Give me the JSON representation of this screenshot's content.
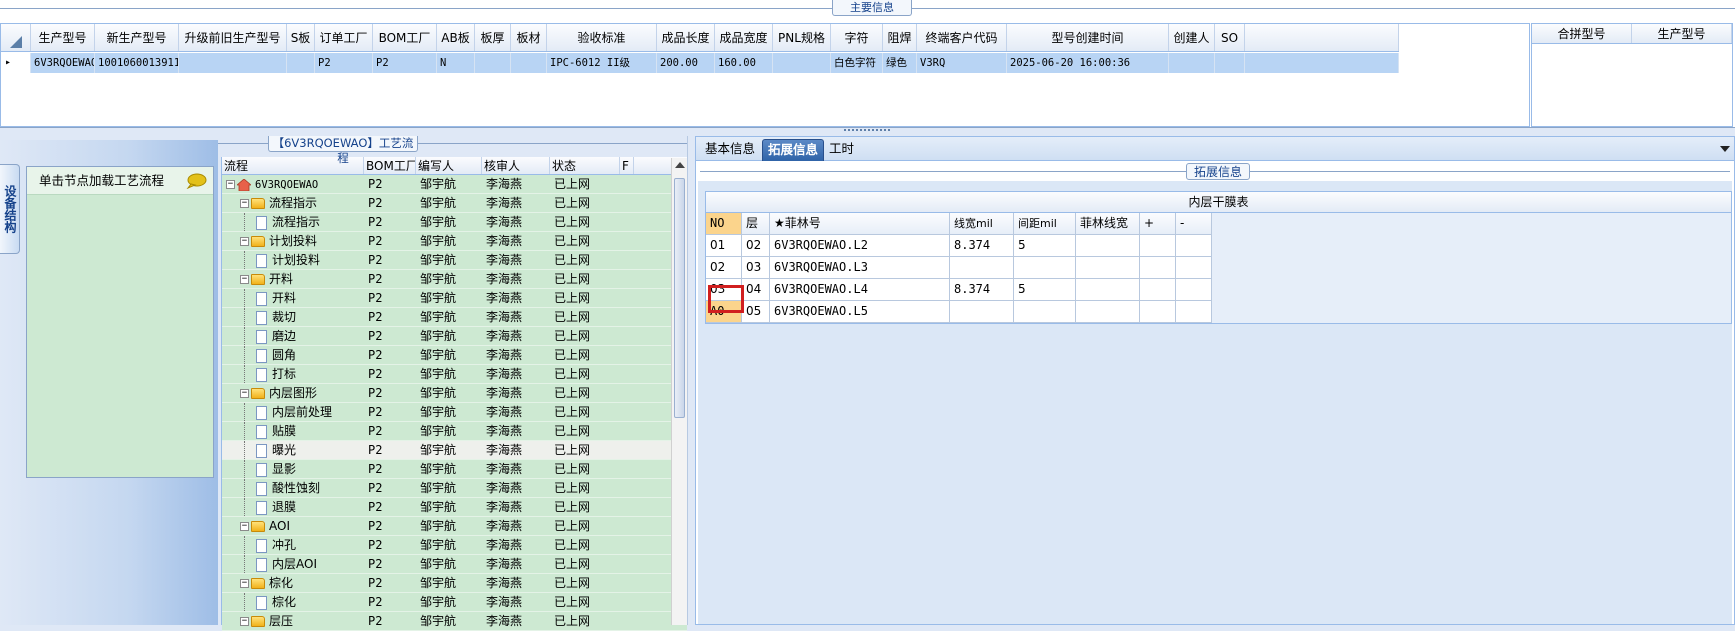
{
  "top": {
    "section_title": "主要信息",
    "columns": [
      "",
      "生产型号",
      "新生产型号",
      "升级前旧生产型号",
      "S板",
      "订单工厂",
      "BOM工厂",
      "AB板",
      "板厚",
      "板材",
      "验收标准",
      "成品长度",
      "成品宽度",
      "PNL规格",
      "字符",
      "阻焊",
      "终端客户代码",
      "型号创建时间",
      "创建人",
      "SO",
      ""
    ],
    "row": [
      "▸",
      "6V3RQOEWAO",
      "10010600139116",
      "",
      "",
      "P2",
      "P2",
      "N",
      "",
      "",
      "IPC-6012 II级",
      "200.00",
      "160.00",
      "",
      "白色字符",
      "绿色",
      "V3RQ",
      "2025-06-20 16:00:36",
      "",
      "",
      ""
    ],
    "merge_columns": [
      "合拼型号",
      "生产型号"
    ]
  },
  "left": {
    "vertical_tab": "设备结构",
    "panel_title": "单击节点加载工艺流程",
    "bubble_icon": "speech-bubble-icon"
  },
  "flow": {
    "title": "【6V3RQOEWAO】工艺流程",
    "columns": [
      "流程",
      "BOM工厂",
      "编写人",
      "核审人",
      "状态",
      "F"
    ],
    "rows": [
      {
        "name": "6V3RQOEWAO",
        "type": "root",
        "level": 0,
        "bom": "P2",
        "writer": "邹宇航",
        "reviewer": "李海燕",
        "status": "已上网"
      },
      {
        "name": "流程指示",
        "type": "folder",
        "level": 1,
        "bom": "P2",
        "writer": "邹宇航",
        "reviewer": "李海燕",
        "status": "已上网"
      },
      {
        "name": "流程指示",
        "type": "doc",
        "level": 2,
        "bom": "P2",
        "writer": "邹宇航",
        "reviewer": "李海燕",
        "status": "已上网"
      },
      {
        "name": "计划投料",
        "type": "folder",
        "level": 1,
        "bom": "P2",
        "writer": "邹宇航",
        "reviewer": "李海燕",
        "status": "已上网"
      },
      {
        "name": "计划投料",
        "type": "doc",
        "level": 2,
        "bom": "P2",
        "writer": "邹宇航",
        "reviewer": "李海燕",
        "status": "已上网"
      },
      {
        "name": "开料",
        "type": "folder",
        "level": 1,
        "bom": "P2",
        "writer": "邹宇航",
        "reviewer": "李海燕",
        "status": "已上网"
      },
      {
        "name": "开料",
        "type": "doc",
        "level": 2,
        "bom": "P2",
        "writer": "邹宇航",
        "reviewer": "李海燕",
        "status": "已上网"
      },
      {
        "name": "裁切",
        "type": "doc",
        "level": 2,
        "bom": "P2",
        "writer": "邹宇航",
        "reviewer": "李海燕",
        "status": "已上网"
      },
      {
        "name": "磨边",
        "type": "doc",
        "level": 2,
        "bom": "P2",
        "writer": "邹宇航",
        "reviewer": "李海燕",
        "status": "已上网"
      },
      {
        "name": "圆角",
        "type": "doc",
        "level": 2,
        "bom": "P2",
        "writer": "邹宇航",
        "reviewer": "李海燕",
        "status": "已上网"
      },
      {
        "name": "打标",
        "type": "doc",
        "level": 2,
        "bom": "P2",
        "writer": "邹宇航",
        "reviewer": "李海燕",
        "status": "已上网"
      },
      {
        "name": "内层图形",
        "type": "folder",
        "level": 1,
        "bom": "P2",
        "writer": "邹宇航",
        "reviewer": "李海燕",
        "status": "已上网"
      },
      {
        "name": "内层前处理",
        "type": "doc",
        "level": 2,
        "bom": "P2",
        "writer": "邹宇航",
        "reviewer": "李海燕",
        "status": "已上网"
      },
      {
        "name": "贴膜",
        "type": "doc",
        "level": 2,
        "bom": "P2",
        "writer": "邹宇航",
        "reviewer": "李海燕",
        "status": "已上网"
      },
      {
        "name": "曝光",
        "type": "doc",
        "level": 2,
        "bom": "P2",
        "writer": "邹宇航",
        "reviewer": "李海燕",
        "status": "已上网",
        "selected": true
      },
      {
        "name": "显影",
        "type": "doc",
        "level": 2,
        "bom": "P2",
        "writer": "邹宇航",
        "reviewer": "李海燕",
        "status": "已上网"
      },
      {
        "name": "酸性蚀刻",
        "type": "doc",
        "level": 2,
        "bom": "P2",
        "writer": "邹宇航",
        "reviewer": "李海燕",
        "status": "已上网"
      },
      {
        "name": "退膜",
        "type": "doc",
        "level": 2,
        "bom": "P2",
        "writer": "邹宇航",
        "reviewer": "李海燕",
        "status": "已上网"
      },
      {
        "name": "AOI",
        "type": "folder",
        "level": 1,
        "bom": "P2",
        "writer": "邹宇航",
        "reviewer": "李海燕",
        "status": "已上网"
      },
      {
        "name": "冲孔",
        "type": "doc",
        "level": 2,
        "bom": "P2",
        "writer": "邹宇航",
        "reviewer": "李海燕",
        "status": "已上网"
      },
      {
        "name": "内层AOI",
        "type": "doc",
        "level": 2,
        "bom": "P2",
        "writer": "邹宇航",
        "reviewer": "李海燕",
        "status": "已上网"
      },
      {
        "name": "棕化",
        "type": "folder",
        "level": 1,
        "bom": "P2",
        "writer": "邹宇航",
        "reviewer": "李海燕",
        "status": "已上网"
      },
      {
        "name": "棕化",
        "type": "doc",
        "level": 2,
        "bom": "P2",
        "writer": "邹宇航",
        "reviewer": "李海燕",
        "status": "已上网"
      },
      {
        "name": "层压",
        "type": "folder",
        "level": 1,
        "bom": "P2",
        "writer": "邹宇航",
        "reviewer": "李海燕",
        "status": "已上网"
      }
    ]
  },
  "right": {
    "tabs": [
      "基本信息",
      "拓展信息",
      "工时"
    ],
    "active_tab": "拓展信息",
    "section_title": "拓展信息",
    "table_title": "内层干膜表",
    "columns": [
      "NO",
      "层",
      "★菲林号",
      "线宽mil",
      "间距mil",
      "菲林线宽",
      "+",
      "-"
    ],
    "rows": [
      [
        "01",
        "02",
        "6V3RQOEWAO.L2",
        "8.374",
        "5",
        "",
        "",
        ""
      ],
      [
        "02",
        "03",
        "6V3RQOEWAO.L3",
        "",
        "",
        "",
        "",
        ""
      ],
      [
        "03",
        "04",
        "6V3RQOEWAO.L4",
        "8.374",
        "5",
        "",
        "",
        ""
      ],
      [
        "A0",
        "05",
        "6V3RQOEWAO.L5",
        "",
        "",
        "",
        "",
        ""
      ]
    ]
  },
  "colors": {
    "row_selected": "#b8d4f4",
    "tree_bg": "#cde9d2",
    "tab_active": "#2f63a8",
    "cell_highlight": "#fbd48c",
    "annotation_box": "#d11f1f"
  }
}
